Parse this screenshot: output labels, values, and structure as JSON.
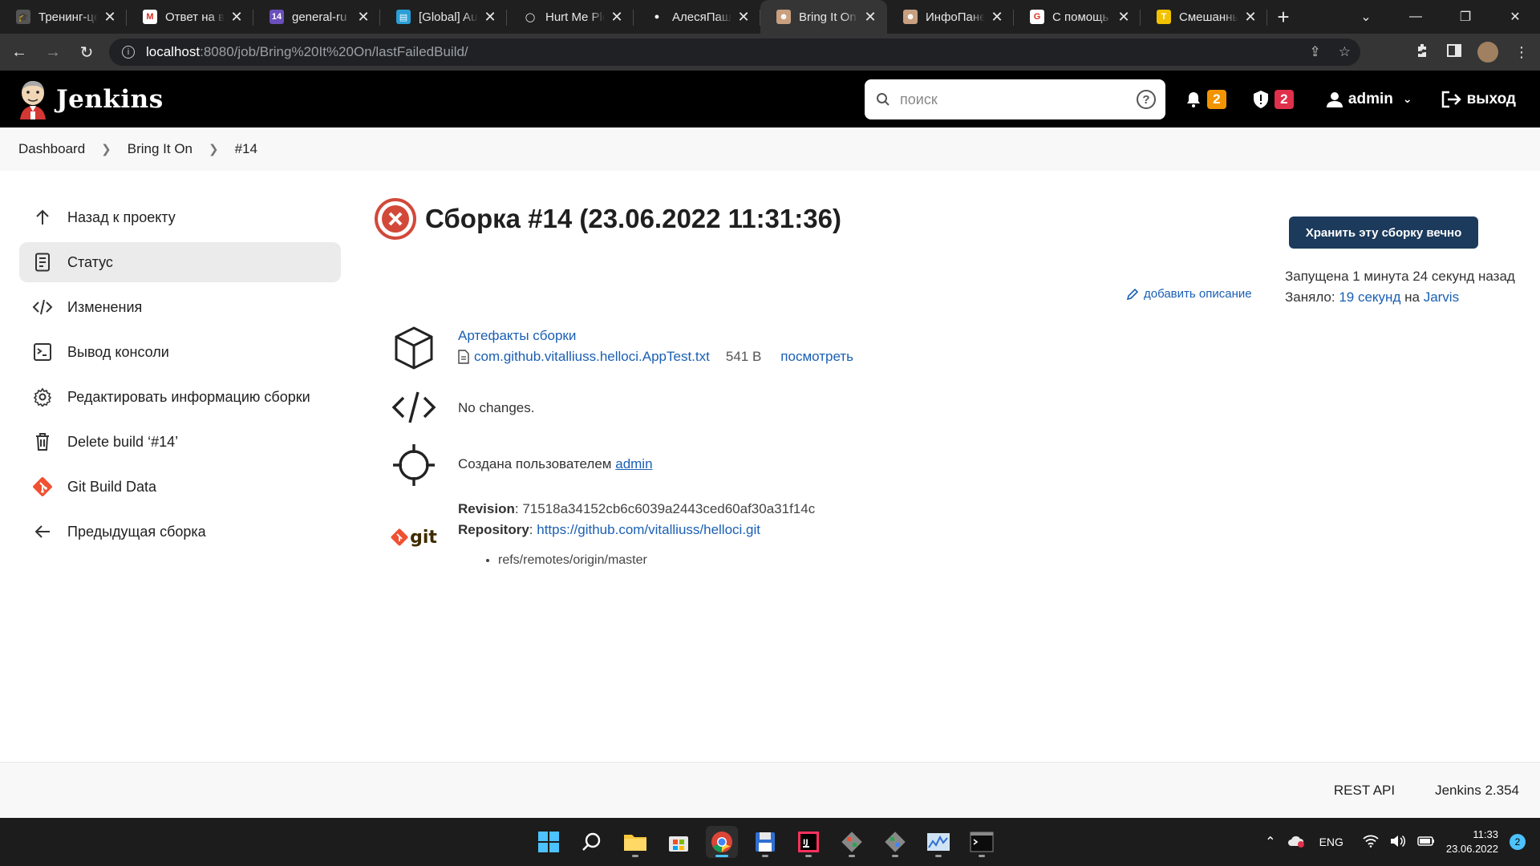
{
  "browser": {
    "tabs": [
      {
        "title": "Тренинг-це",
        "fav_color": "#555555",
        "fav_glyph": "🎓",
        "active": false
      },
      {
        "title": "Ответ на в",
        "fav_color": "#ffffff",
        "fav_glyph": "M",
        "active": false
      },
      {
        "title": "general-ru",
        "fav_color": "#6b4fbb",
        "fav_glyph": "14",
        "active": false
      },
      {
        "title": "[Global] Au",
        "fav_color": "#2a9fd6",
        "fav_glyph": "▤",
        "active": false
      },
      {
        "title": "Hurt Me Ple",
        "fav_color": "#1f1f1f",
        "fav_glyph": "◯",
        "active": false
      },
      {
        "title": "АлесяПаш",
        "fav_color": "#1f1f1f",
        "fav_glyph": "●",
        "active": false
      },
      {
        "title": "Bring It On",
        "fav_color": "#c8a080",
        "fav_glyph": "☻",
        "active": true
      },
      {
        "title": "ИнфоПане",
        "fav_color": "#c8a080",
        "fav_glyph": "☻",
        "active": false
      },
      {
        "title": "С помощь",
        "fav_color": "#ffffff",
        "fav_glyph": "G",
        "active": false
      },
      {
        "title": "Смешанны",
        "fav_color": "#f2c200",
        "fav_glyph": "T",
        "active": false
      }
    ],
    "url_host": "localhost",
    "url_path": ":8080/job/Bring%20It%20On/lastFailedBuild/"
  },
  "jenkins": {
    "brand": "Jenkins",
    "search_placeholder": "поиск",
    "notifications_count": "2",
    "security_count": "2",
    "user": "admin",
    "logout": "выход"
  },
  "breadcrumb": [
    "Dashboard",
    "Bring It On",
    "#14"
  ],
  "sidebar": {
    "items": [
      {
        "label": "Назад к проекту",
        "icon": "arrow-up-icon"
      },
      {
        "label": "Статус",
        "icon": "document-icon"
      },
      {
        "label": "Изменения",
        "icon": "code-icon"
      },
      {
        "label": "Вывод консоли",
        "icon": "terminal-icon"
      },
      {
        "label": "Редактировать информацию сборки",
        "icon": "gear-icon"
      },
      {
        "label": "Delete build ‘#14’",
        "icon": "trash-icon"
      },
      {
        "label": "Git Build Data",
        "icon": "git-icon"
      },
      {
        "label": "Предыдущая сборка",
        "icon": "arrow-left-icon"
      }
    ]
  },
  "build": {
    "title": "Сборка #14 (23.06.2022 11:31:36)",
    "keep_button": "Хранить эту сборку вечно",
    "started": "Запущена 1 минута 24 секунд назад",
    "took_label": "Заняло:",
    "duration": "19 секунд",
    "on_label": "на",
    "agent": "Jarvis",
    "add_description": "добавить описание",
    "artifacts_title": "Артефакты сборки",
    "artifact_file": "com.github.vitalliuss.helloci.AppTest.txt",
    "artifact_size": "541 B",
    "artifact_view": "посмотреть",
    "no_changes": "No changes.",
    "created_by_label": "Создана пользователем",
    "created_by_user": "admin",
    "git_word": "git",
    "revision_label": "Revision",
    "revision": "71518a34152cb6c6039a2443ced60af30a31f14c",
    "repository_label": "Repository",
    "repository": "https://github.com/vitalliuss/helloci.git",
    "refs": [
      "refs/remotes/origin/master"
    ],
    "status_color": "#d24939"
  },
  "footer": {
    "rest_api": "REST API",
    "version": "Jenkins 2.354"
  },
  "taskbar": {
    "lang": "ENG",
    "time": "11:33",
    "date": "23.06.2022",
    "notif_count": "2"
  }
}
